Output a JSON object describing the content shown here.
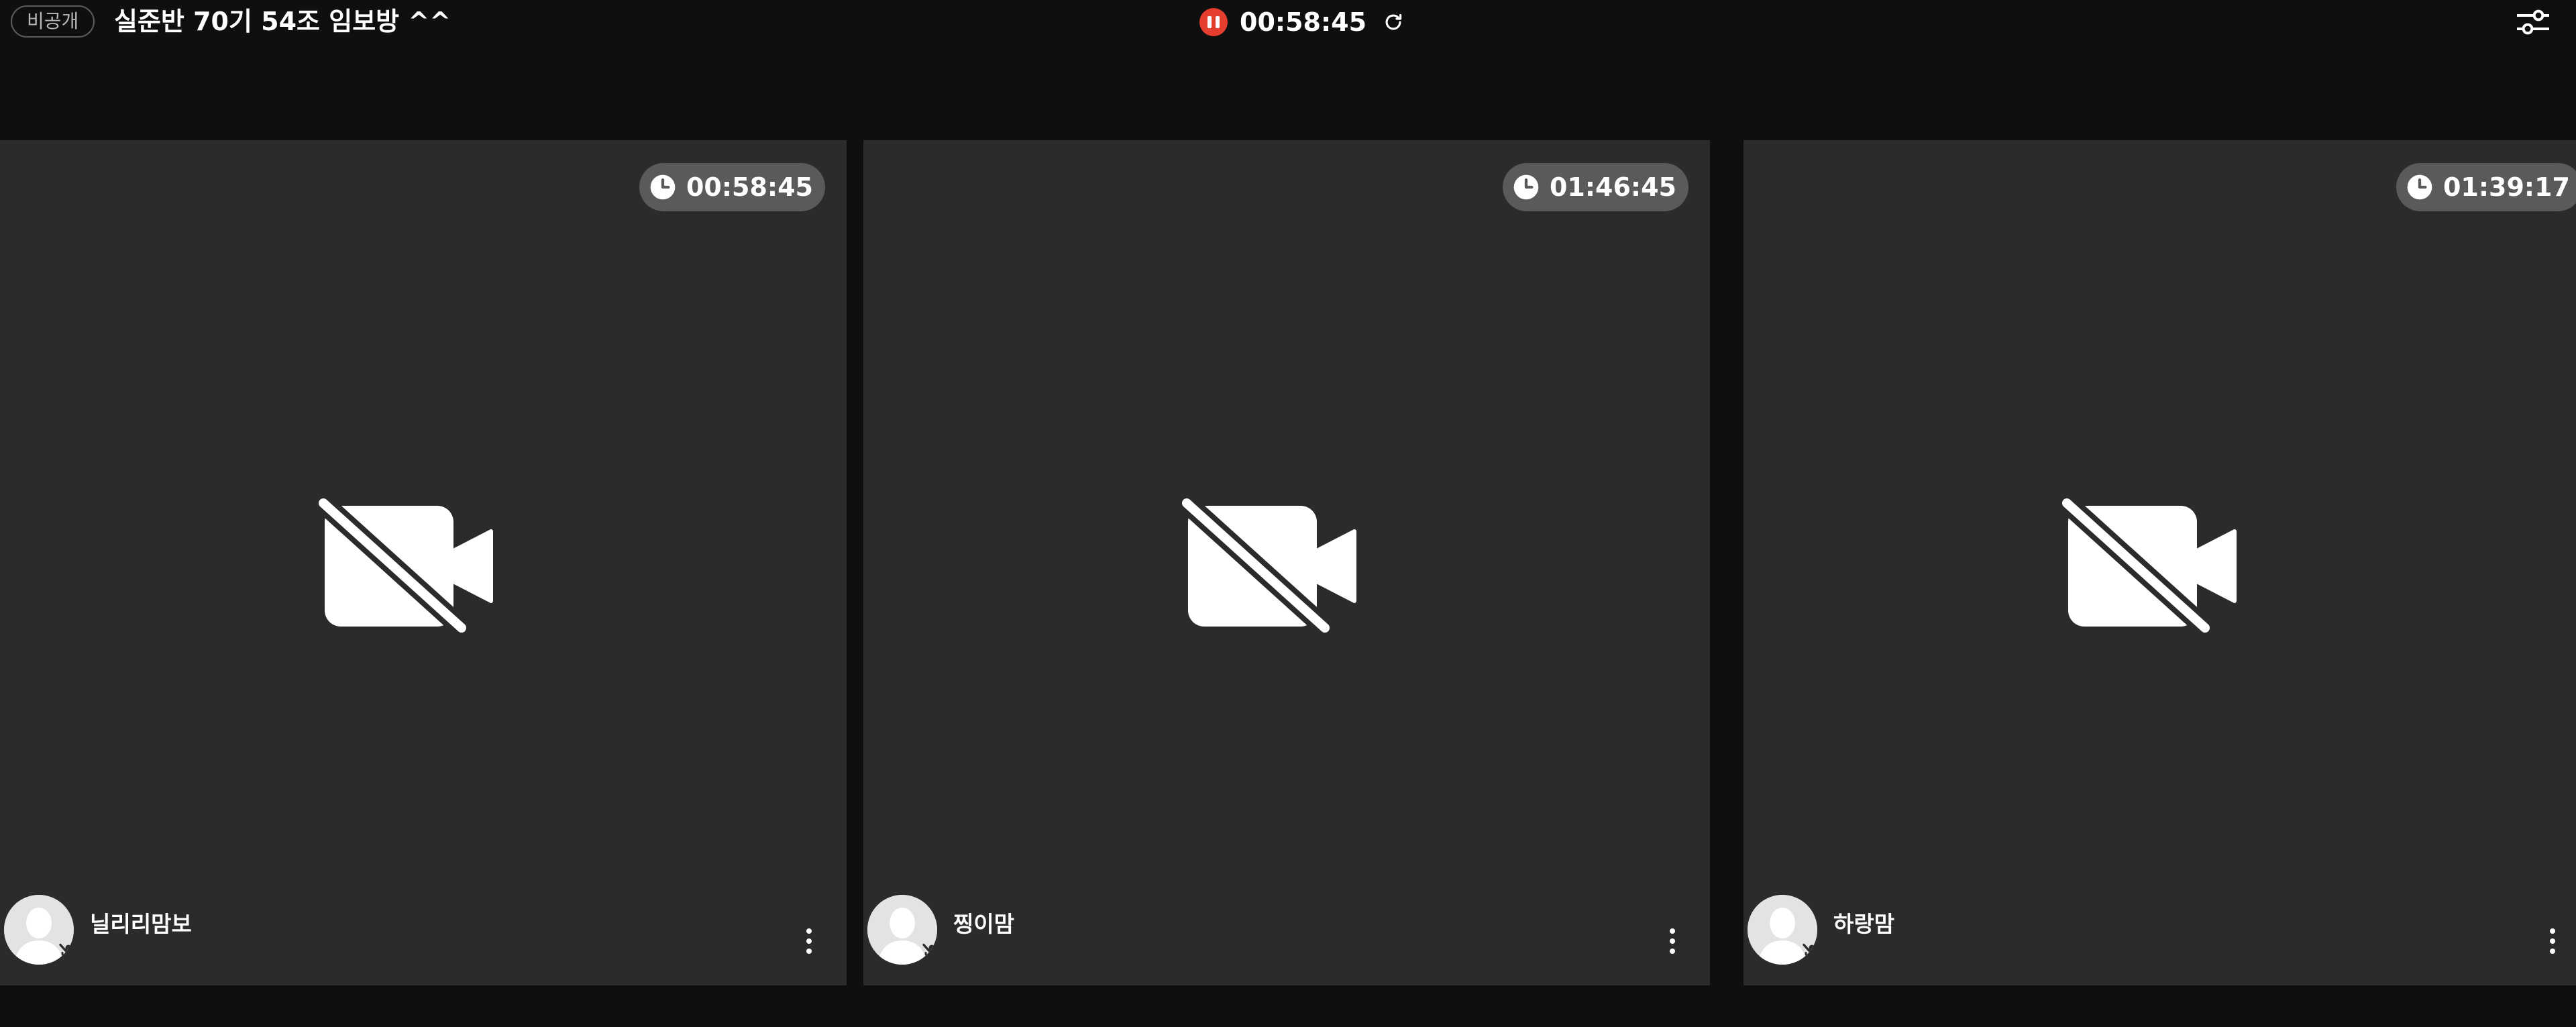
{
  "header": {
    "privacy_badge": "비공개",
    "room_title": "실준반 70기 54조 임보방 ^^",
    "session_timer": "00:58:45",
    "pause_icon": "pause-icon",
    "refresh_icon": "refresh-icon",
    "settings_icon": "sliders-icon"
  },
  "participants": [
    {
      "name": "닐리리맘보",
      "study_time": "00:58:45",
      "camera": "off",
      "mic": "off"
    },
    {
      "name": "찡이맘",
      "study_time": "01:46:45",
      "camera": "off",
      "mic": "off"
    },
    {
      "name": "하랑맘",
      "study_time": "01:39:17",
      "camera": "off",
      "mic": "off"
    }
  ],
  "colors": {
    "background": "#0f0f0f",
    "tile": "#2b2b2b",
    "chip": "#5a5a5a",
    "record_accent": "#e53e2e",
    "text": "#ffffff"
  }
}
